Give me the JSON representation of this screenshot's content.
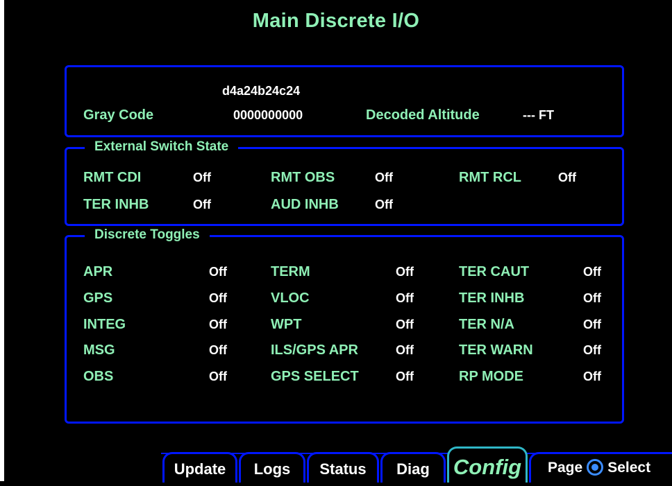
{
  "title": "Main Discrete I/O",
  "altitude": {
    "hex_code": "d4a24b24c24",
    "gray_code_label": "Gray Code",
    "gray_code_value": "0000000000",
    "decoded_altitude_label": "Decoded Altitude",
    "decoded_altitude_value": "--- FT"
  },
  "external_switch": {
    "title": "External Switch State",
    "items": [
      {
        "label": "RMT CDI",
        "value": "Off"
      },
      {
        "label": "RMT OBS",
        "value": "Off"
      },
      {
        "label": "RMT RCL",
        "value": "Off"
      },
      {
        "label": "TER INHB",
        "value": "Off"
      },
      {
        "label": "AUD INHB",
        "value": "Off"
      }
    ]
  },
  "discrete_toggles": {
    "title": "Discrete Toggles",
    "items": [
      {
        "label": "APR",
        "value": "Off"
      },
      {
        "label": "TERM",
        "value": "Off"
      },
      {
        "label": "TER CAUT",
        "value": "Off"
      },
      {
        "label": "GPS",
        "value": "Off"
      },
      {
        "label": "VLOC",
        "value": "Off"
      },
      {
        "label": "TER INHB",
        "value": "Off"
      },
      {
        "label": "INTEG",
        "value": "Off"
      },
      {
        "label": "WPT",
        "value": "Off"
      },
      {
        "label": "TER N/A",
        "value": "Off"
      },
      {
        "label": "MSG",
        "value": "Off"
      },
      {
        "label": "ILS/GPS APR",
        "value": "Off"
      },
      {
        "label": "TER WARN",
        "value": "Off"
      },
      {
        "label": "OBS",
        "value": "Off"
      },
      {
        "label": "GPS SELECT",
        "value": "Off"
      },
      {
        "label": "RP MODE",
        "value": "Off"
      }
    ]
  },
  "tabs": [
    {
      "label": "Update"
    },
    {
      "label": "Logs"
    },
    {
      "label": "Status"
    },
    {
      "label": "Diag"
    },
    {
      "label": "Config",
      "active": true
    }
  ],
  "softkey": {
    "page_label": "Page",
    "select_label": "Select"
  },
  "colors": {
    "accent": "#8ff0b6",
    "border": "#0016ff",
    "active_tab": "#2fb7c7",
    "value": "#ffffff"
  }
}
